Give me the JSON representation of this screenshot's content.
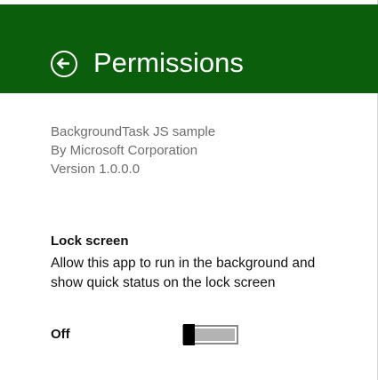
{
  "header": {
    "title": "Permissions",
    "background": "#0b5f0c"
  },
  "app": {
    "name": "BackgroundTask JS sample",
    "publisher": "By Microsoft Corporation",
    "version": "Version 1.0.0.0"
  },
  "lock_screen": {
    "title": "Lock screen",
    "description": "Allow this app to run in the background and show quick status on the lock screen",
    "state_label": "Off",
    "enabled": false
  },
  "icons": {
    "back": "back-arrow-circle-icon"
  }
}
